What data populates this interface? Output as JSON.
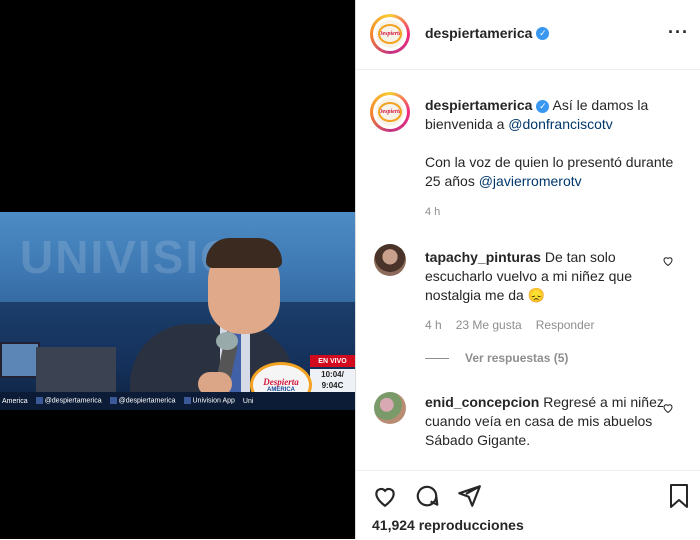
{
  "video": {
    "ticker": [
      "America",
      "@despiertamerica",
      "@despiertamerica",
      "Univision App",
      "Uni"
    ],
    "live_label": "EN VIVO",
    "clock_lines": [
      "10:04/",
      "9:04C"
    ],
    "logo_text": "Despierta",
    "logo_sub": "AMERICA",
    "bg_word": "UNIVISION"
  },
  "post": {
    "username": "despiertamerica",
    "verified_mark": "✓",
    "more_label": "···"
  },
  "caption": {
    "username": "despiertamerica",
    "text_1": " Así le damos la bienvenida a ",
    "mention_1": "@donfranciscotv",
    "text_2": "Con la voz de quien lo presentó durante 25 años ",
    "mention_2": "@javierromerotv",
    "time": "4 h"
  },
  "comments": [
    {
      "username": "tapachy_pinturas",
      "text": " De tan solo escucharlo vuelvo a mi niñez que nostalgia me da 😞",
      "time": "4 h",
      "likes": "23 Me gusta",
      "reply_label": "Responder",
      "view_replies": "Ver respuestas (5)"
    },
    {
      "username": "enid_concepcion",
      "text": " Regresé a mi niñez cuando veía en casa de mis abuelos Sábado Gigante."
    }
  ],
  "footer": {
    "views": "41,924 reproducciones"
  },
  "icons": [
    "heart-icon",
    "comment-icon",
    "share-icon",
    "bookmark-icon",
    "more-icon",
    "verified-icon"
  ],
  "colors": {
    "accent": "#3897f0",
    "mention": "#00376b",
    "muted": "#8e8e8e",
    "text": "#262626"
  }
}
